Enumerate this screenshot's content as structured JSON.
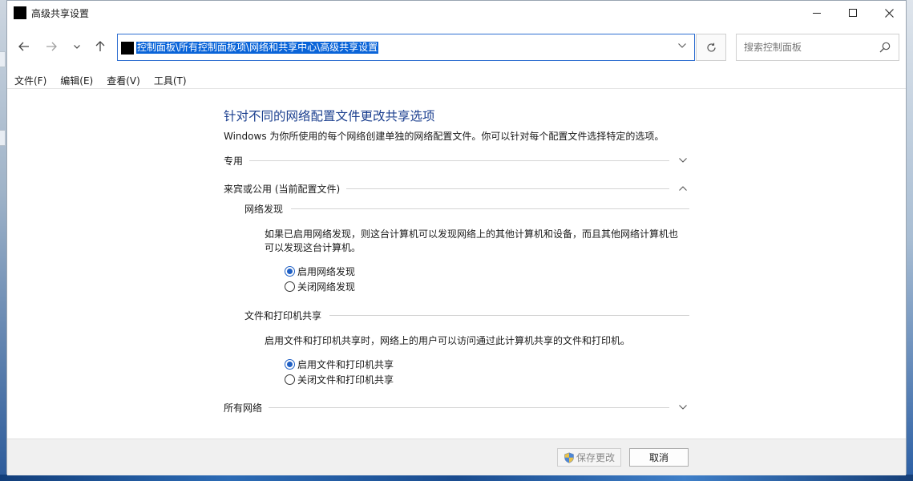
{
  "window": {
    "title": "高级共享设置"
  },
  "address": {
    "path": "控制面板\\所有控制面板项\\网络和共享中心\\高级共享设置"
  },
  "search": {
    "placeholder": "搜索控制面板"
  },
  "menu": {
    "items": [
      {
        "label": "文件(F)"
      },
      {
        "label": "编辑(E)"
      },
      {
        "label": "查看(V)"
      },
      {
        "label": "工具(T)"
      }
    ]
  },
  "main": {
    "title": "针对不同的网络配置文件更改共享选项",
    "description": "Windows 为你所使用的每个网络创建单独的网络配置文件。你可以针对每个配置文件选择特定的选项。",
    "sections": [
      {
        "label": "专用",
        "expanded": false
      },
      {
        "label": "来宾或公用 (当前配置文件)",
        "expanded": true
      },
      {
        "label": "所有网络",
        "expanded": false
      }
    ],
    "network_discovery": {
      "heading": "网络发现",
      "description_line1": "如果已启用网络发现，则这台计算机可以发现网络上的其他计算机和设备，而且其他网络计算机也",
      "description_line2": "可以发现这台计算机。",
      "options": [
        {
          "label": "启用网络发现",
          "checked": true
        },
        {
          "label": "关闭网络发现",
          "checked": false
        }
      ]
    },
    "file_printer_sharing": {
      "heading": "文件和打印机共享",
      "description": "启用文件和打印机共享时，网络上的用户可以访问通过此计算机共享的文件和打印机。",
      "options": [
        {
          "label": "启用文件和打印机共享",
          "checked": true
        },
        {
          "label": "关闭文件和打印机共享",
          "checked": false
        }
      ]
    }
  },
  "footer": {
    "save_label": "保存更改",
    "save_enabled": false,
    "cancel_label": "取消"
  },
  "colors": {
    "accent": "#1f5fc4",
    "title_blue": "#1b3f8f",
    "selection": "#0a64d8"
  }
}
